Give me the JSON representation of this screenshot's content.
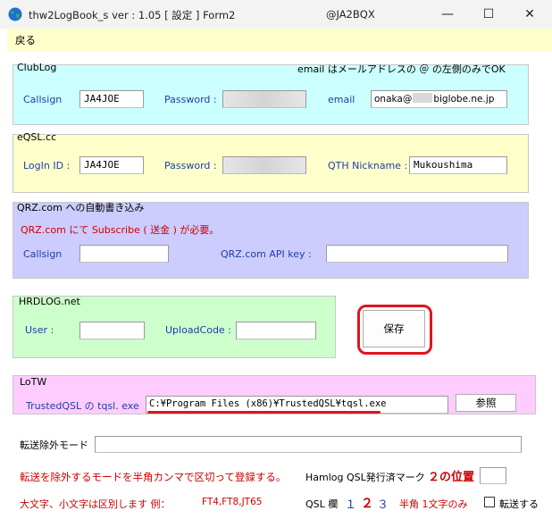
{
  "window": {
    "title": "thw2LogBook_s  ver : 1.05  [ 設定 ]     Form2",
    "callsign_title": "@JA2BQX",
    "controls": {
      "minimize": "—",
      "maximize": "☐",
      "close": "✕"
    }
  },
  "menu": {
    "back": "戻る"
  },
  "clublog": {
    "group_label": "ClubLog",
    "note": "email はメールアドレスの  ＠  の左側のみでOK",
    "callsign_label": "Callsign",
    "callsign_value": "JA4JOE",
    "password_label": "Password :",
    "email_label": "email",
    "email_prefix": "onaka@",
    "email_suffix": "biglobe.ne.jp"
  },
  "eqsl": {
    "group_label": "eQSL.cc",
    "login_label": "LogIn ID :",
    "login_value": "JA4JOE",
    "password_label": "Password :",
    "qth_label": "QTH Nickname :",
    "qth_value": "Mukoushima"
  },
  "qrz": {
    "group_label": "QRZ.com への自動書き込み",
    "notice": "QRZ.com にて  Subscribe ( 送金 ) が必要。",
    "callsign_label": "Callsign",
    "callsign_value": "",
    "apikey_label": "QRZ.com  API key :",
    "apikey_value": ""
  },
  "hrdlog": {
    "group_label": "HRDLOG.net",
    "user_label": "User :",
    "user_value": "",
    "upload_label": "UploadCode :",
    "upload_value": ""
  },
  "save_button": "保存",
  "lotw": {
    "group_label": "LoTW",
    "path_label": "TrustedQSL の tqsl. exe",
    "path_value": "C:¥Program Files (x86)¥TrustedQSL¥tqsl.exe",
    "browse_button": "参照"
  },
  "exclude": {
    "label": "転送除外モード",
    "value": "",
    "instruction": "転送を除外するモードを半角カンマで区切って登録する。",
    "case_note": "大文字、小文字は区別します  例：",
    "example": "FT4,FT8,JT65"
  },
  "hamlog": {
    "mark_label": "Hamlog QSL発行済マーク",
    "position_label": "２の位置",
    "mark_value": "",
    "qsl_col_label": "QSL 欄",
    "qsl_col_1": "１",
    "qsl_col_2": "２",
    "qsl_col_3": "３",
    "halfwidth_label": "半角  1文字のみ",
    "transfer_label": "転送する"
  },
  "colors": {
    "clublog_bg": "#ccffff",
    "eqsl_bg": "#ffffcc",
    "qrz_bg": "#ccccff",
    "hrdlog_bg": "#ccffcc",
    "lotw_bg": "#ffccff",
    "menu_bg": "#ffffcc",
    "label_blue": "#1f3fa0",
    "notice_red": "#cc0000",
    "highlight_red": "#e0141e"
  }
}
